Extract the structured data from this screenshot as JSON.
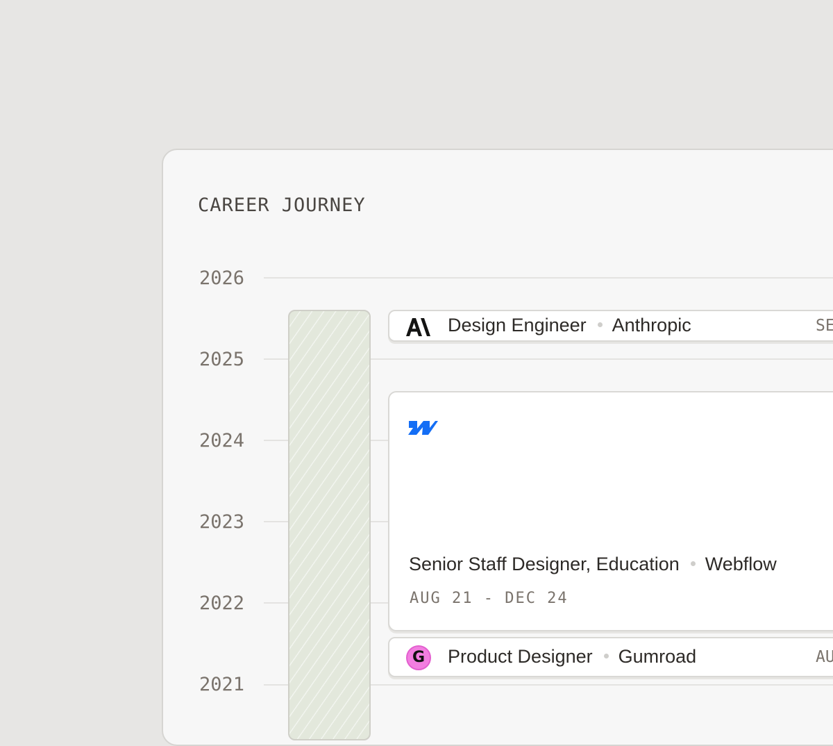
{
  "section": {
    "title": "CAREER JOURNEY"
  },
  "timeline": {
    "years": [
      "2026",
      "2025",
      "2024",
      "2023",
      "2022",
      "2021"
    ]
  },
  "jobs": [
    {
      "role": "Design Engineer",
      "company": "Anthropic",
      "date": "SE",
      "logo": "anthropic-logo"
    },
    {
      "role": "Senior Staff Designer, Education",
      "company": "Webflow",
      "date": "AUG 21 - DEC 24",
      "logo": "webflow-logo"
    },
    {
      "role": "Product Designer",
      "company": "Gumroad",
      "date": "AU",
      "logo": "gumroad-logo",
      "logo_letter": "G"
    }
  ],
  "colors": {
    "background": "#e7e6e4",
    "panel": "#f7f7f7",
    "track": "#e3e8dc",
    "webflow_blue": "#146ef5",
    "gumroad_pink": "#f27ee0"
  }
}
